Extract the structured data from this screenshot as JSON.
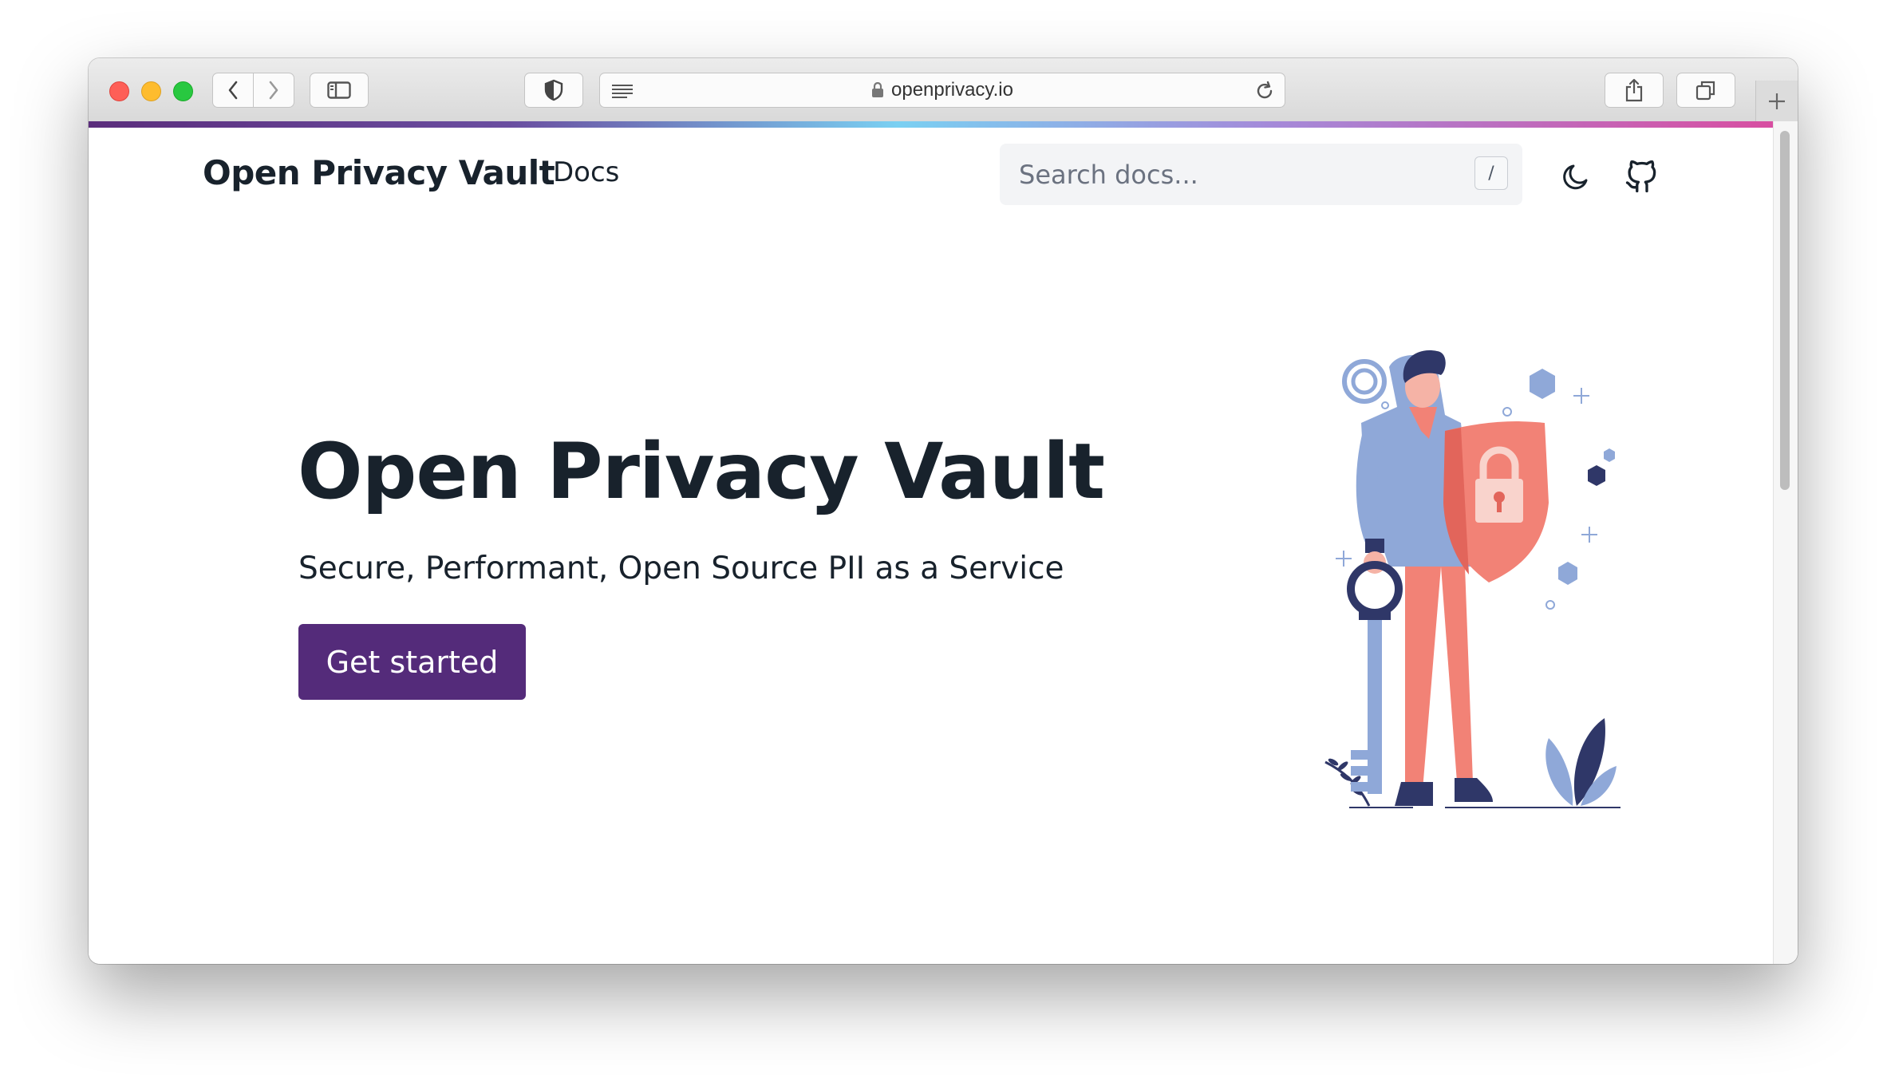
{
  "browser": {
    "url": "openprivacy.io"
  },
  "nav": {
    "brand": "Open Privacy Vault",
    "docs_link": "Docs",
    "search_placeholder": "Search docs...",
    "search_shortcut": "/"
  },
  "hero": {
    "title": "Open Privacy Vault",
    "subtitle": "Secure, Performant, Open Source PII as a Service",
    "cta_label": "Get started"
  },
  "icons": {
    "traffic_lights": [
      "close-icon",
      "minimize-icon",
      "zoom-icon"
    ],
    "toolbar": [
      "back-icon",
      "forward-icon",
      "sidebar-icon",
      "shield-icon",
      "reader-icon",
      "lock-icon",
      "reload-icon",
      "share-icon",
      "tabs-icon",
      "plus-icon"
    ],
    "nav": [
      "moon-icon",
      "github-icon"
    ]
  },
  "colors": {
    "brand_purple": "#542b7a",
    "text_dark": "#18222c",
    "illustration_coral": "#f28276",
    "illustration_blue": "#8fa8d8",
    "illustration_navy": "#2f3768"
  }
}
